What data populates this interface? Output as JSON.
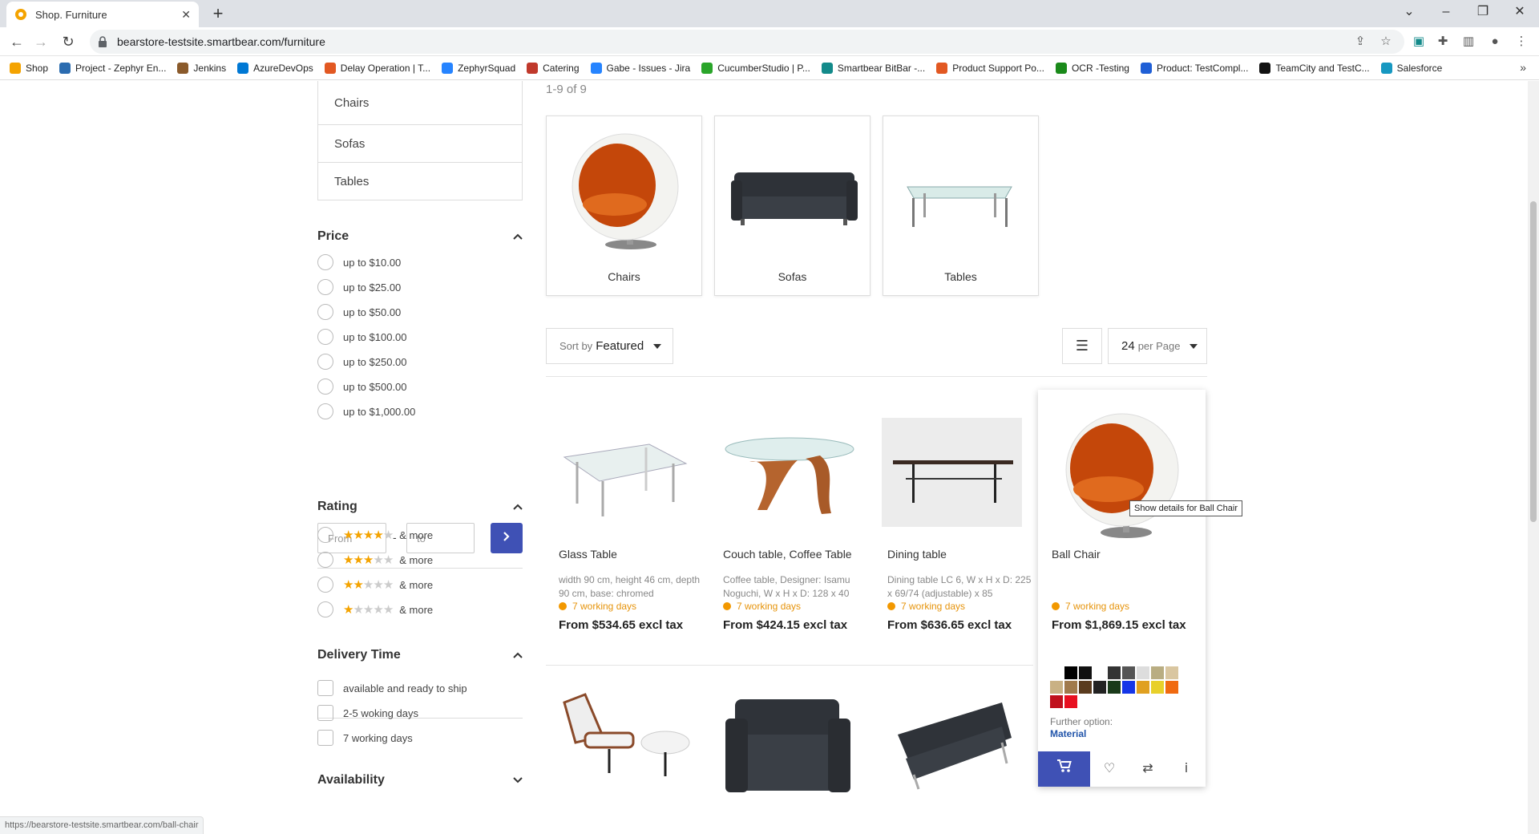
{
  "browser": {
    "tab_title": "Shop. Furniture",
    "url": "bearstore-testsite.smartbear.com/furniture",
    "bookmarks": [
      "Shop",
      "Project - Zephyr En...",
      "Jenkins",
      "AzureDevOps",
      "Delay Operation | T...",
      "ZephyrSquad",
      "Catering",
      "Gabe - Issues - Jira",
      "CucumberStudio | P...",
      "Smartbear BitBar -...",
      "Product Support Po...",
      "OCR -Testing",
      "Product: TestCompl...",
      "TeamCity and TestC...",
      "Salesforce"
    ],
    "bookmark_colors": [
      "#f4a300",
      "#2b6cb0",
      "#8a5a2b",
      "#0078d4",
      "#e25822",
      "#2684ff",
      "#c0392b",
      "#2684ff",
      "#2aa52a",
      "#138a8a",
      "#e25822",
      "#1a8a1a",
      "#1f5fd6",
      "#111111",
      "#1798c1"
    ],
    "status_url": "https://bearstore-testsite.smartbear.com/ball-chair"
  },
  "sidebar": {
    "categories": [
      "Chairs",
      "Sofas",
      "Tables"
    ],
    "price": {
      "title": "Price",
      "options": [
        "up to $10.00",
        "up to $25.00",
        "up to $50.00",
        "up to $100.00",
        "up to $250.00",
        "up to $500.00",
        "up to $1,000.00"
      ],
      "from_placeholder": "From",
      "dash": "-",
      "to_placeholder": "to"
    },
    "rating": {
      "title": "Rating",
      "options": [
        {
          "stars": 4,
          "label": "& more"
        },
        {
          "stars": 3,
          "label": "& more"
        },
        {
          "stars": 2,
          "label": "& more"
        },
        {
          "stars": 1,
          "label": "& more"
        }
      ]
    },
    "delivery": {
      "title": "Delivery Time",
      "options": [
        "available and ready to ship",
        "2-5 woking days",
        "7 working days"
      ]
    },
    "availability": {
      "title": "Availability"
    }
  },
  "main": {
    "result_count": "1-9 of 9",
    "category_tiles": [
      "Chairs",
      "Sofas",
      "Tables"
    ],
    "sort_prefix": "Sort by",
    "sort_value": "Featured",
    "per_page_value": "24",
    "per_page_suffix": "per Page",
    "products": [
      {
        "name": "Glass Table",
        "desc": "width 90 cm, height 46 cm, depth 90 cm, base: chromed",
        "delivery": "7 working days",
        "price": "From $534.65 excl tax"
      },
      {
        "name": "Couch table, Coffee Table",
        "desc": "Coffee table, Designer: Isamu Noguchi, W x H x D: 128 x 40",
        "delivery": "7 working days",
        "price": "From $424.15 excl tax"
      },
      {
        "name": "Dining table",
        "desc": "Dining table LC 6, W x H x D: 225 x 69/74 (adjustable) x 85",
        "delivery": "7 working days",
        "price": "From $636.65 excl tax"
      },
      {
        "name": "Ball Chair",
        "desc": "",
        "delivery": "7 working days",
        "price": "From $1,869.15 excl tax"
      }
    ],
    "hover": {
      "swatch_colors": [
        "#ffffff",
        "#000000",
        "#111111",
        "#ffffff",
        "#333333",
        "#555555",
        "#dddddd",
        "#b9ad82",
        "#d9c6a0",
        "#c9b184",
        "#a07a4c",
        "#5a3b1e",
        "#222222",
        "#1a3a1a",
        "#1536e8",
        "#e0a020",
        "#e8d02a",
        "#f06a10",
        "#c0101c",
        "#e81020"
      ],
      "further_label": "Further option:",
      "further_link": "Material",
      "tooltip": "Show details for Ball Chair"
    }
  }
}
